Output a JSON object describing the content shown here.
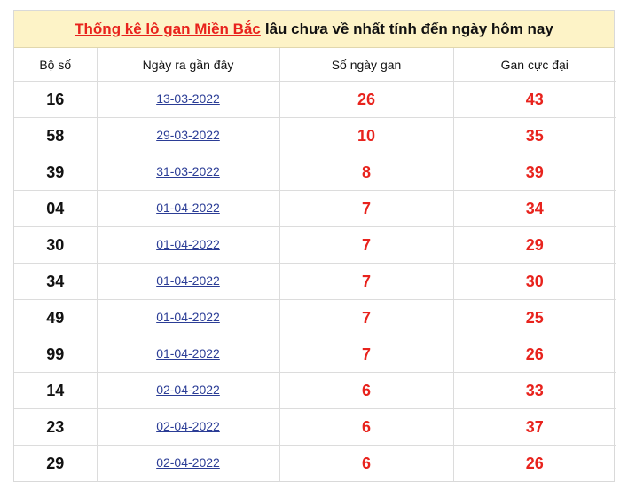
{
  "title": {
    "link_text": "Thống kê lô gan Miền Bắc",
    "rest_text": "lâu chưa về nhất tính đến ngày hôm nay"
  },
  "columns": [
    "Bộ số",
    "Ngày ra gần đây",
    "Số ngày gan",
    "Gan cực đại"
  ],
  "rows": [
    {
      "number": "16",
      "date": "13-03-2022",
      "days": "26",
      "max": "43"
    },
    {
      "number": "58",
      "date": "29-03-2022",
      "days": "10",
      "max": "35"
    },
    {
      "number": "39",
      "date": "31-03-2022",
      "days": "8",
      "max": "39"
    },
    {
      "number": "04",
      "date": "01-04-2022",
      "days": "7",
      "max": "34"
    },
    {
      "number": "30",
      "date": "01-04-2022",
      "days": "7",
      "max": "29"
    },
    {
      "number": "34",
      "date": "01-04-2022",
      "days": "7",
      "max": "30"
    },
    {
      "number": "49",
      "date": "01-04-2022",
      "days": "7",
      "max": "25"
    },
    {
      "number": "99",
      "date": "01-04-2022",
      "days": "7",
      "max": "26"
    },
    {
      "number": "14",
      "date": "02-04-2022",
      "days": "6",
      "max": "33"
    },
    {
      "number": "23",
      "date": "02-04-2022",
      "days": "6",
      "max": "37"
    },
    {
      "number": "29",
      "date": "02-04-2022",
      "days": "6",
      "max": "26"
    }
  ],
  "colors": {
    "title_background": "#fdf3c7",
    "accent_red": "#e8231d",
    "link_blue": "#2b3d96"
  }
}
